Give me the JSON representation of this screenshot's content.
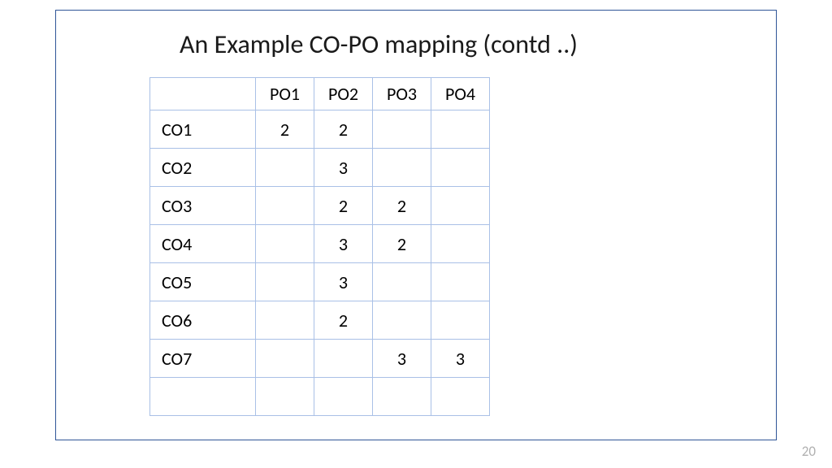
{
  "title": "An Example CO-PO mapping (contd ..)",
  "page_number": "20",
  "table": {
    "corner": "",
    "columns": [
      "PO1",
      "PO2",
      "PO3",
      "PO4"
    ],
    "rows": [
      {
        "label": "CO1",
        "cells": [
          "2",
          "2",
          "",
          ""
        ]
      },
      {
        "label": "CO2",
        "cells": [
          "",
          "3",
          "",
          ""
        ]
      },
      {
        "label": "CO3",
        "cells": [
          "",
          "2",
          "2",
          ""
        ]
      },
      {
        "label": "CO4",
        "cells": [
          "",
          "3",
          "2",
          ""
        ]
      },
      {
        "label": "CO5",
        "cells": [
          "",
          "3",
          "",
          ""
        ]
      },
      {
        "label": "CO6",
        "cells": [
          "",
          "2",
          "",
          ""
        ]
      },
      {
        "label": "CO7",
        "cells": [
          "",
          "",
          "3",
          "3"
        ]
      },
      {
        "label": "",
        "cells": [
          "",
          "",
          "",
          ""
        ]
      }
    ]
  },
  "chart_data": {
    "type": "table",
    "title": "An Example CO-PO mapping (contd ..)",
    "columns": [
      "",
      "PO1",
      "PO2",
      "PO3",
      "PO4"
    ],
    "rows": [
      [
        "CO1",
        2,
        2,
        null,
        null
      ],
      [
        "CO2",
        null,
        3,
        null,
        null
      ],
      [
        "CO3",
        null,
        2,
        2,
        null
      ],
      [
        "CO4",
        null,
        3,
        2,
        null
      ],
      [
        "CO5",
        null,
        3,
        null,
        null
      ],
      [
        "CO6",
        null,
        2,
        null,
        null
      ],
      [
        "CO7",
        null,
        null,
        3,
        3
      ]
    ]
  }
}
